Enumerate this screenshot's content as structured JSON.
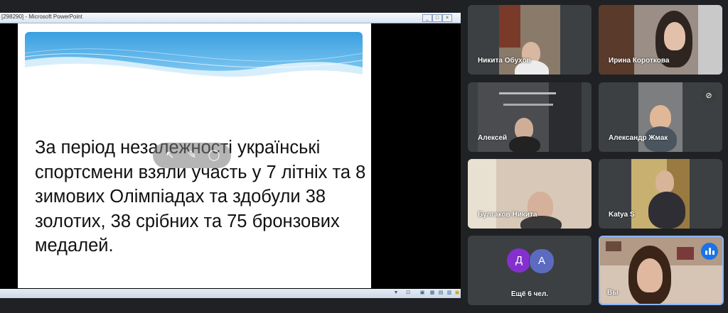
{
  "presentation": {
    "window_title": "[298290] - Microsoft PowerPoint",
    "window_buttons": [
      "_",
      "□",
      "×"
    ],
    "slide_text": "За період незалежності українські спортсмени взяли участь у 7 літніх та 8 зимових Олімпіадах та здобули 38 золотих, 38 срібних та 75 бронзових  медалей."
  },
  "participants": [
    {
      "name": "Никита Обухов",
      "muted": false
    },
    {
      "name": "Ирина Короткова",
      "muted": false
    },
    {
      "name": "Алексей",
      "muted": false
    },
    {
      "name": "Александр Жмак",
      "muted": true
    },
    {
      "name": "Булгаков Никита",
      "muted": false
    },
    {
      "name": "Katya S",
      "muted": false
    }
  ],
  "more": {
    "avatars": [
      {
        "letter": "Д",
        "color": "#8430ce"
      },
      {
        "letter": "А",
        "color": "#5c6bc0"
      }
    ],
    "label": "Ещё 6 чел."
  },
  "self_tile": {
    "name": "Вы",
    "speaking": true
  },
  "colors": {
    "background": "#202124",
    "tile": "#3c4043",
    "accent": "#8ab4f8",
    "speaking": "#1a73e8"
  }
}
